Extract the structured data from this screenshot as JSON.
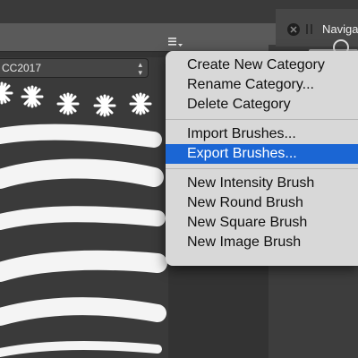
{
  "navigator_panel": {
    "tab_label": "Naviga"
  },
  "brushes_panel": {
    "category_select": {
      "value": "CC2017",
      "arrows": "⌃⌄"
    }
  },
  "context_menu": {
    "groups": [
      [
        {
          "label": "Create New Category"
        },
        {
          "label": "Rename Category..."
        },
        {
          "label": "Delete Category"
        }
      ],
      [
        {
          "label": "Import Brushes..."
        },
        {
          "label": "Export Brushes...",
          "highlighted": true
        }
      ],
      [
        {
          "label": "New Intensity Brush"
        },
        {
          "label": "New Round Brush"
        },
        {
          "label": "New Square Brush"
        },
        {
          "label": "New Image Brush"
        }
      ]
    ]
  },
  "colors": {
    "highlight": "#1b66d4",
    "menu_background": "#d8d8d8",
    "panel_background": "#3a3a3a"
  },
  "icons": [
    "panel-menu-icon",
    "close-icon",
    "pause-icon",
    "zoom-circle-icon"
  ]
}
